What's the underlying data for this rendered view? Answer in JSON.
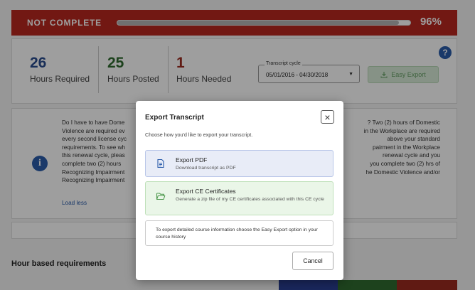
{
  "banner": {
    "status": "NOT COMPLETE",
    "progress_fraction": 0.96,
    "percent_label": "96%",
    "color": "#b8281f"
  },
  "stats": [
    {
      "value": "26",
      "label": "Hours Required",
      "color": "#2a4d8f"
    },
    {
      "value": "25",
      "label": "Hours Posted",
      "color": "#2f6b2f"
    },
    {
      "value": "1",
      "label": "Hours Needed",
      "color": "#9c2a1f"
    }
  ],
  "help_icon": "question-circle-icon",
  "transcript_cycle": {
    "legend": "Transcript cycle",
    "value": "05/01/2016 - 04/30/2018"
  },
  "easy_export_label": "Easy Export",
  "info": {
    "icon": "info-circle-icon",
    "left_lines": [
      "Do I have to have Dome",
      "Violence are required ev",
      "every second license cyc",
      "requirements. To see wh",
      "this renewal cycle, pleas",
      "complete two (2) hours",
      "Recognizing Impairment",
      "Recognizing Impairment"
    ],
    "right_lines": [
      "? Two (2) hours of Domestic",
      "in the Workplace are required",
      "above your standard",
      "pairment in the Workplace",
      "renewal cycle and you",
      "you complete two (2) hrs of",
      "he Domestic Violence and/or",
      ""
    ],
    "load_less": "Load less"
  },
  "section_title": "Hour based requirements",
  "bottom_bars": [
    {
      "color": "#2b3f95"
    },
    {
      "color": "#2f6b2f"
    },
    {
      "color": "#9c2a1f"
    }
  ],
  "modal": {
    "title": "Export Transcript",
    "subtitle": "Choose how you'd like to export your transcript.",
    "close_icon": "close-icon",
    "options": [
      {
        "title": "Export PDF",
        "description": "Download transcript as PDF",
        "icon": "document-icon",
        "accent": "#2a5caa"
      },
      {
        "title": "Export CE Certificates",
        "description": "Generate a zip file of my CE certificates associated with this CE cycle",
        "icon": "folder-open-icon",
        "accent": "#4f9a4f"
      }
    ],
    "note": "To export detailed course information choose the Easy Export option in your course history",
    "cancel_label": "Cancel"
  }
}
